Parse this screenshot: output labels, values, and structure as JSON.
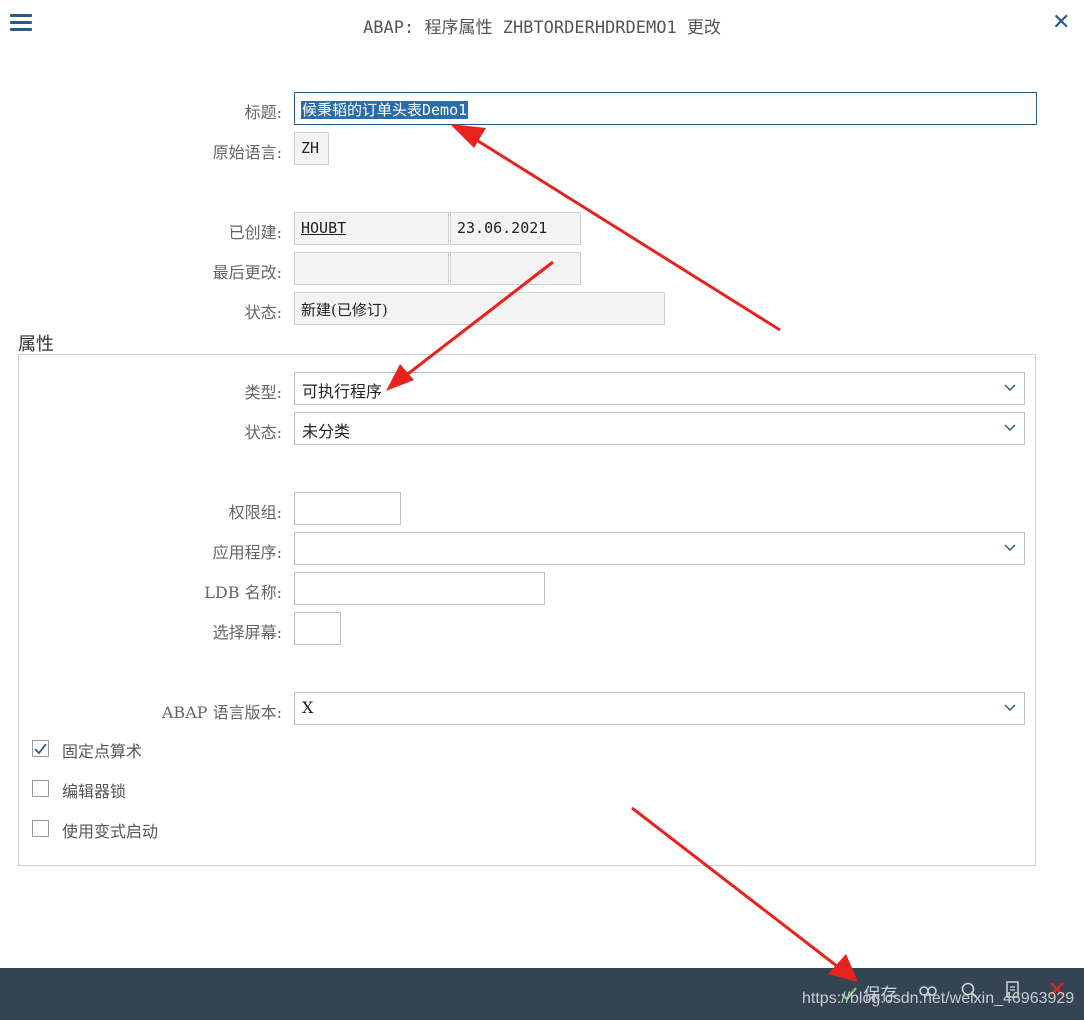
{
  "header": {
    "title": "ABAP: 程序属性 ZHBTORDERHDRDEMO1 更改"
  },
  "form": {
    "title_label": "标题:",
    "title_value": "候秉韬的订单头表Demo1",
    "orig_lang_label": "原始语言:",
    "orig_lang_value": "ZH",
    "created_label": "已创建:",
    "created_user": "HOUBT",
    "created_date": "23.06.2021",
    "last_change_label": "最后更改:",
    "status_label": "状态:",
    "status_value": "新建(已修订)"
  },
  "attributes": {
    "group_title": "属性",
    "type_label": "类型:",
    "type_value": "可执行程序",
    "status_label": "状态:",
    "status_value": "未分类",
    "auth_group_label": "权限组:",
    "application_label": "应用程序:",
    "ldb_label": "LDB 名称:",
    "selection_screen_label": "选择屏幕:",
    "abap_version_label": "ABAP 语言版本:",
    "abap_version_value": "X",
    "checkboxes": [
      {
        "label": "固定点算术",
        "checked": true
      },
      {
        "label": "编辑器锁",
        "checked": false
      },
      {
        "label": "使用变式启动",
        "checked": false
      }
    ]
  },
  "footer": {
    "save_label": "保存"
  },
  "watermark": "https://blog.csdn.net/weixin_46963929",
  "colors": {
    "accent": "#2b5a8a",
    "footer_bg": "#354452",
    "arrow": "#e8231f"
  }
}
